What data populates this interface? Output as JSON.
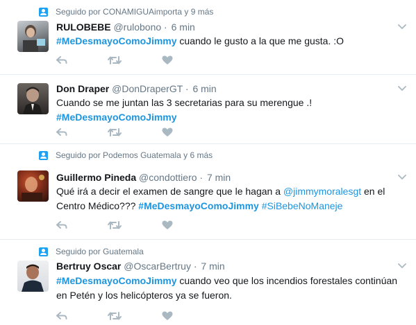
{
  "tweets": [
    {
      "context": "Seguido por CONAMIGUAimporta y 9 más",
      "name": "RULOBEBE",
      "handle": "@rulobono",
      "dot": "·",
      "time": "6 min",
      "parts": [
        {
          "t": "#MeDesmayoComoJimmy",
          "k": "tag"
        },
        {
          "t": " cuando le gusto a la que me gusta. :O",
          "k": "text"
        }
      ]
    },
    {
      "context": "",
      "name": "Don Draper",
      "handle": "@DonDraperGT",
      "dot": "·",
      "time": "6 min",
      "parts": [
        {
          "t": "Cuando se me juntan las 3 secretarias para su merengue .!",
          "k": "text"
        },
        {
          "t": "\n",
          "k": "br"
        },
        {
          "t": "#MeDesmayoComoJimmy",
          "k": "tag"
        }
      ]
    },
    {
      "context": "Seguido por Podemos Guatemala y 6 más",
      "name": "Guillermo Pineda",
      "handle": "@condottiero",
      "dot": "·",
      "time": "7 min",
      "parts": [
        {
          "t": "Qué irá a decir el examen de sangre que le hagan a ",
          "k": "text"
        },
        {
          "t": "@jimmymoralesgt",
          "k": "mention"
        },
        {
          "t": "  en el Centro Médico??? ",
          "k": "text"
        },
        {
          "t": "#MeDesmayoComoJimmy",
          "k": "tag"
        },
        {
          "t": " ",
          "k": "text"
        },
        {
          "t": "#SiBebeNoManeje",
          "k": "link"
        }
      ]
    },
    {
      "context": "Seguido por Guatemala",
      "name": "Bertruy Oscar",
      "handle": "@OscarBertruy",
      "dot": "·",
      "time": "7 min",
      "parts": [
        {
          "t": "#MeDesmayoComoJimmy",
          "k": "tag"
        },
        {
          "t": " cuando veo que los incendios forestales continúan en Petén y los helicópteros ya se fueron.",
          "k": "text"
        }
      ]
    }
  ],
  "icons": {
    "context": "person-icon",
    "reply": "reply-icon",
    "retweet": "retweet-icon",
    "like": "heart-icon",
    "more": "chevron-down-icon"
  },
  "colors": {
    "link": "#1b95e0",
    "secondary": "#657786",
    "action": "#aab8c2",
    "divider": "#e6ecf0"
  }
}
